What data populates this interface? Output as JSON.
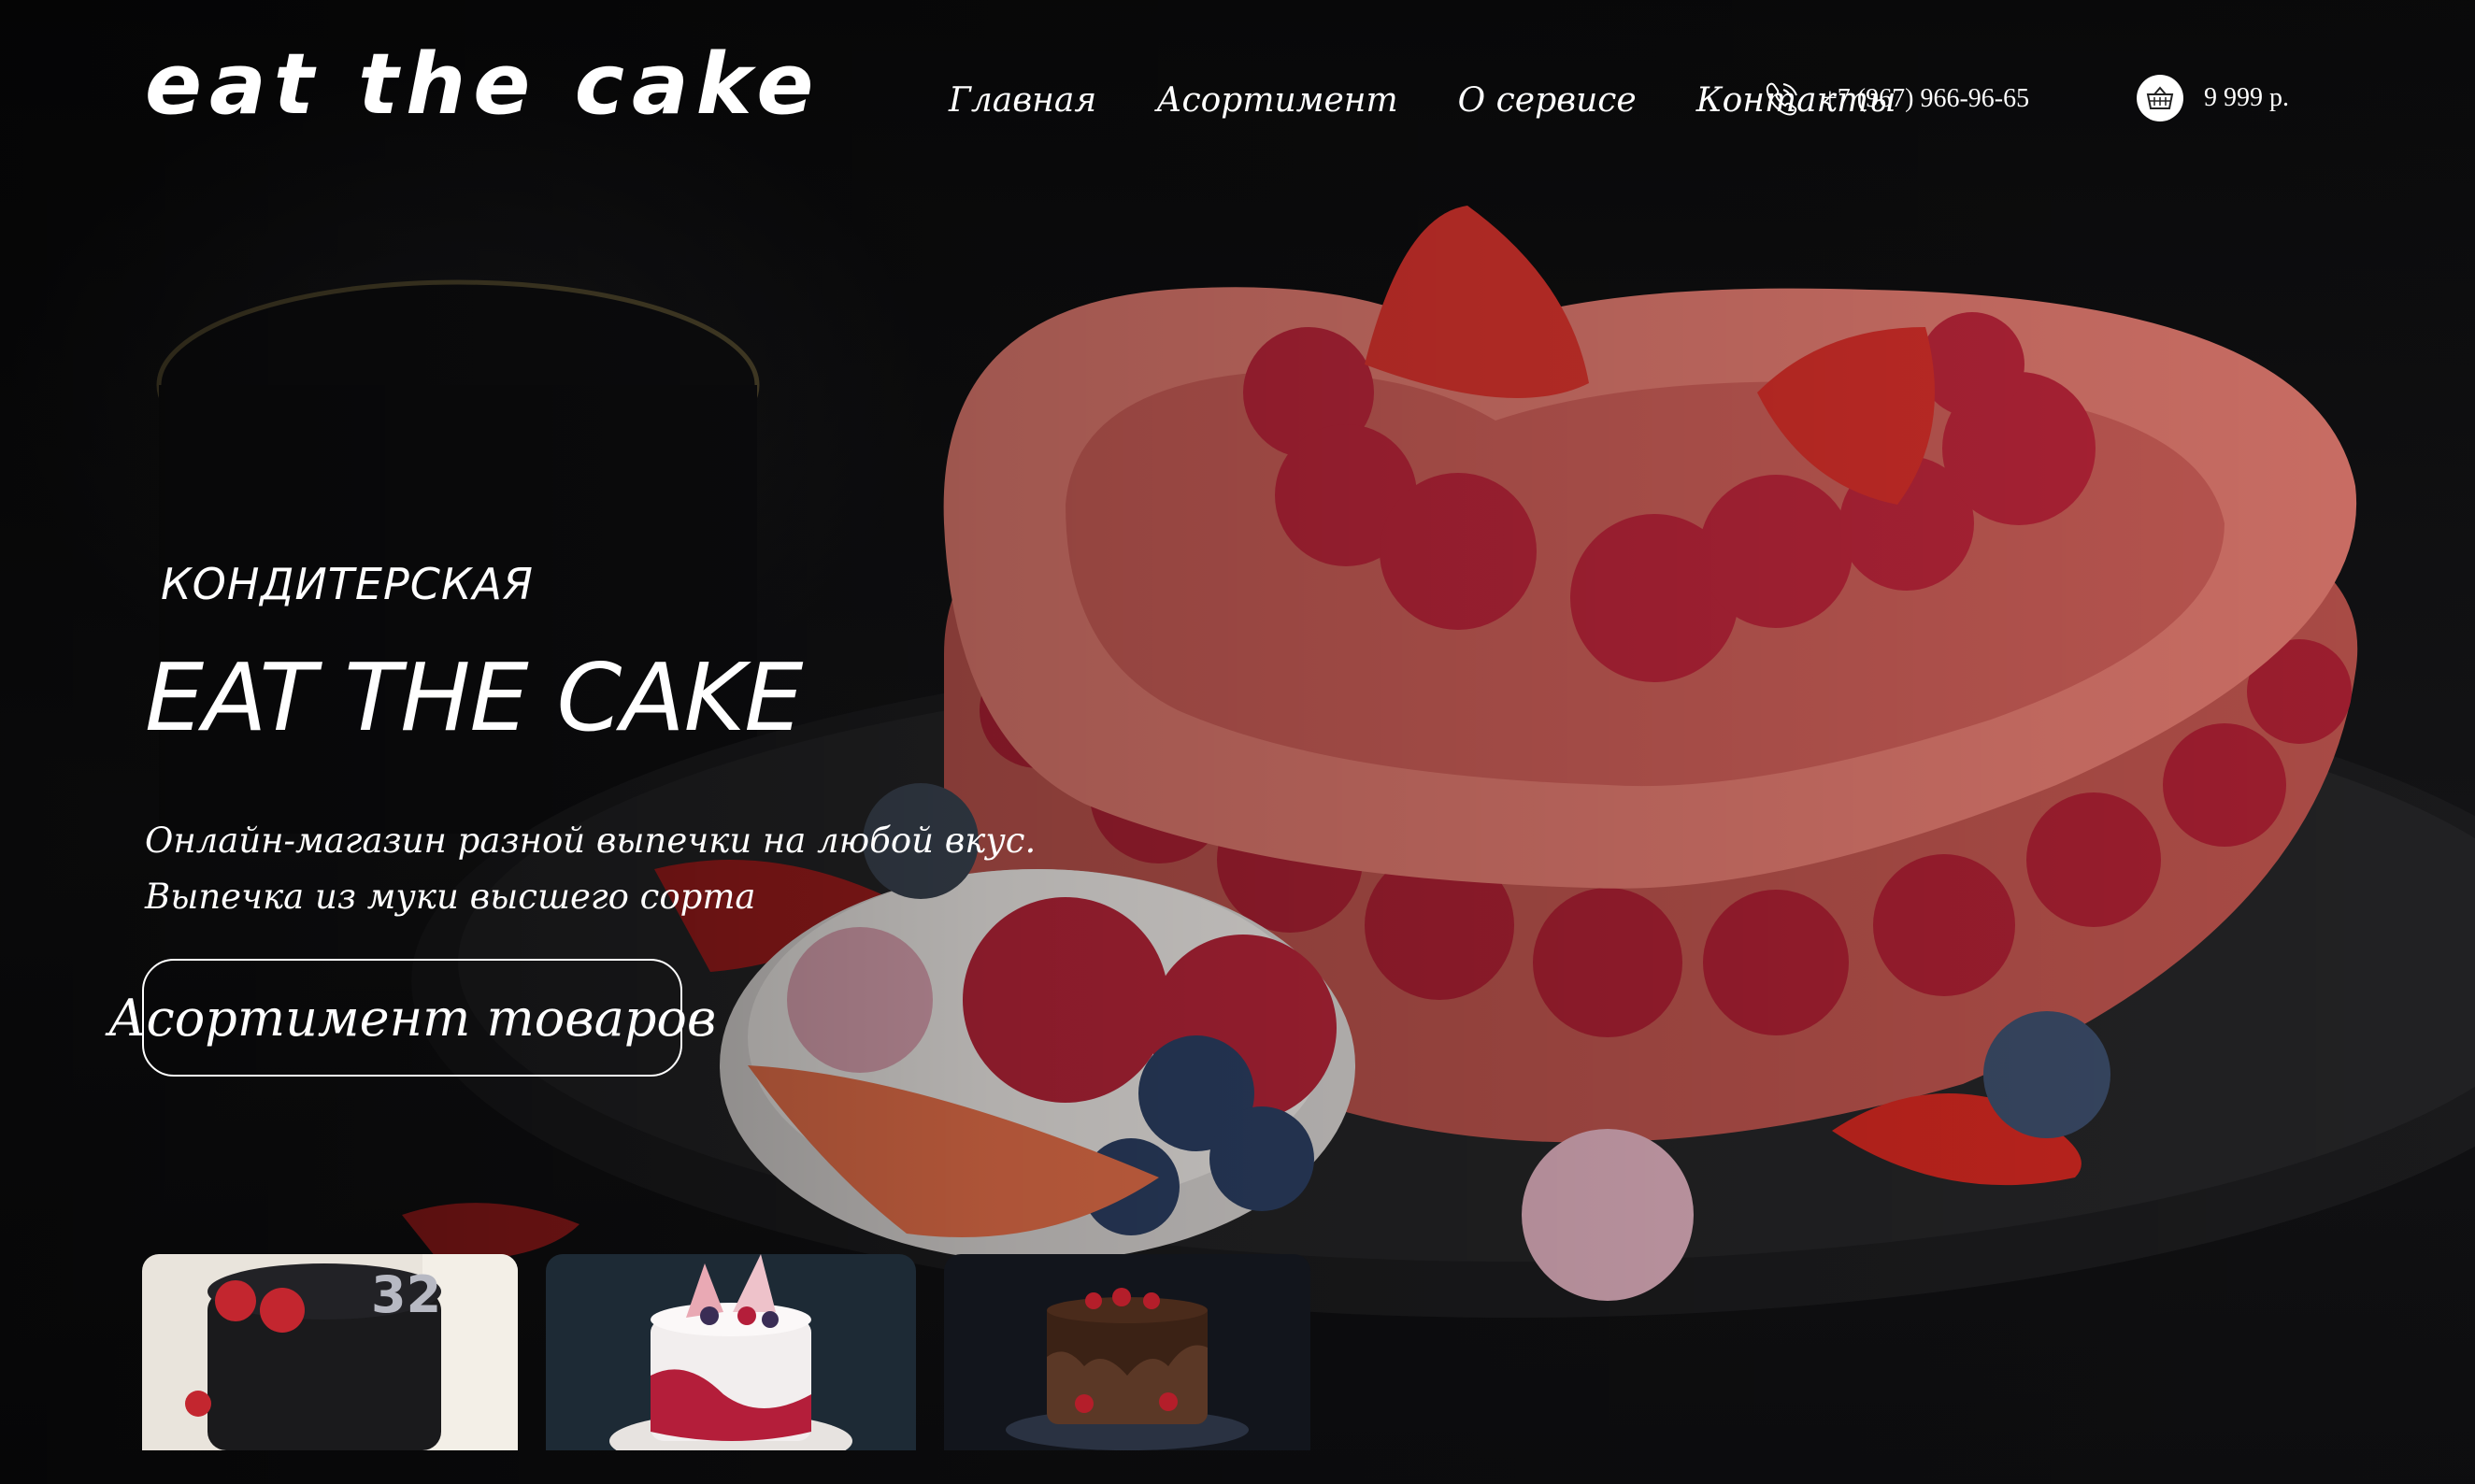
{
  "header": {
    "logo": "eat the cake",
    "nav": [
      "Главная",
      "Асортимент",
      "О сервисе",
      "Контакты"
    ],
    "phone": "+7 (967) 966-96-65",
    "cart_total": "9 999 р."
  },
  "hero": {
    "kicker": "КОНДИТЕРСКАЯ",
    "title": "EAT THE CAKE",
    "desc_line1": "Онлайн-магазин разной выпечки на любой вкус.",
    "desc_line2": "Выпечка из муки высшего сорта",
    "cta": "Асортимент товаров"
  },
  "thumbnails": [
    "black-cake-photo",
    "white-berry-cake-photo",
    "chocolate-cake-photo"
  ],
  "icons": {
    "phone": "phone-icon",
    "cart": "basket-icon"
  },
  "colors": {
    "background": "#0c0c0d",
    "text": "#ffffff",
    "accent_berry": "#c1323f"
  }
}
